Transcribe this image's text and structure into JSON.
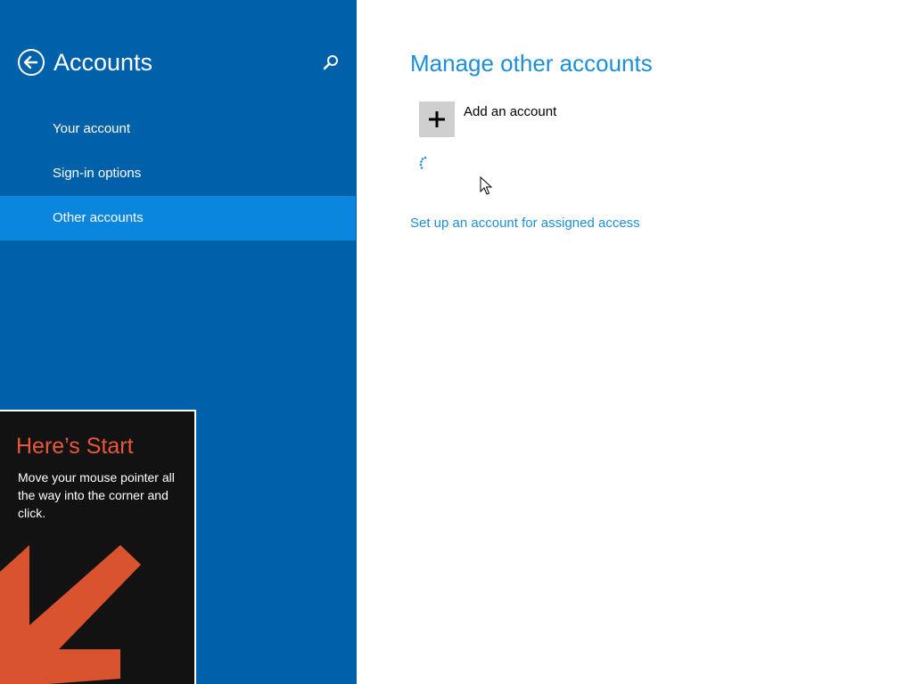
{
  "sidebar": {
    "title": "Accounts",
    "back_icon": "back-arrow-icon",
    "search_icon": "search-icon",
    "items": [
      {
        "label": "Your account",
        "selected": false
      },
      {
        "label": "Sign-in options",
        "selected": false
      },
      {
        "label": "Other accounts",
        "selected": true
      }
    ],
    "colors": {
      "background": "#0061ab",
      "selected": "#0a86de"
    }
  },
  "main": {
    "title": "Manage other accounts",
    "add_account_label": "Add an account",
    "add_icon": "plus-icon",
    "assigned_access_link": "Set up an account for assigned access",
    "accent": "#1d8fd6"
  },
  "tip": {
    "title": "Here’s Start",
    "body": "Move your mouse pointer all the way into the corner and click.",
    "accent": "#e8573a",
    "arrow_icon": "corner-arrow-icon"
  }
}
